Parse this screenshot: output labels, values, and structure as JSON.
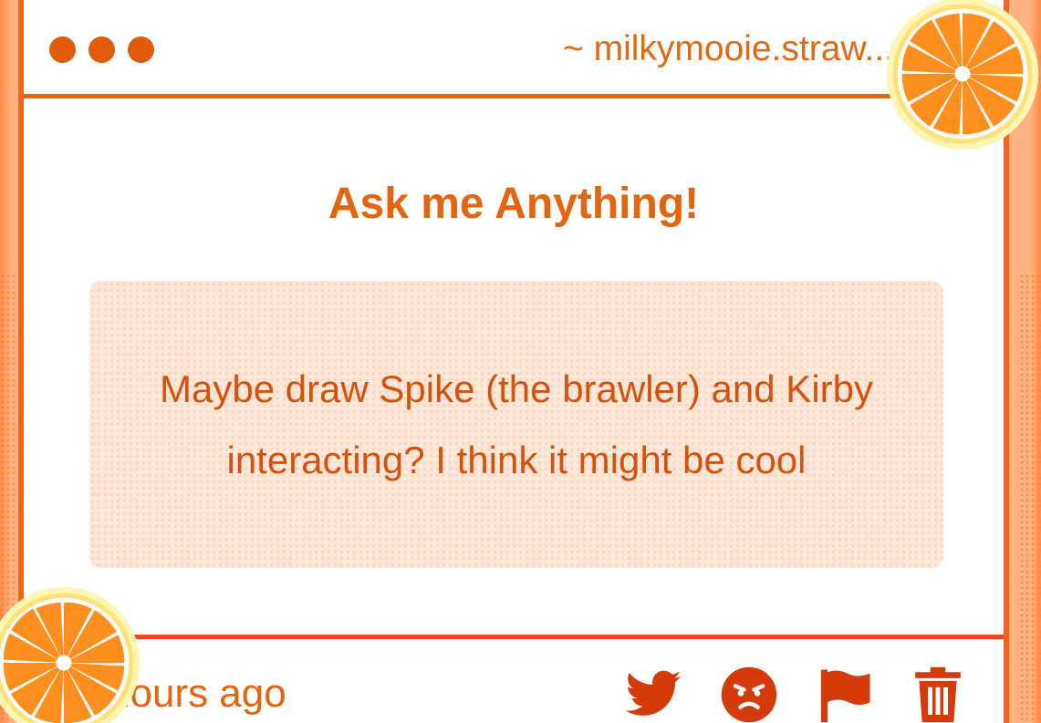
{
  "header": {
    "username": "~ milkymooie.straw..."
  },
  "main": {
    "title": "Ask me Anything!",
    "message": "Maybe draw Spike (the brawler) and Kirby interacting? I think it might be cool"
  },
  "footer": {
    "timestamp": "hours ago",
    "actions": [
      {
        "icon": "twitter-icon",
        "label": "Share on Twitter"
      },
      {
        "icon": "angry-face-icon",
        "label": "Dislike"
      },
      {
        "icon": "flag-icon",
        "label": "Report"
      },
      {
        "icon": "trash-icon",
        "label": "Delete"
      }
    ]
  },
  "colors": {
    "accent": "#e3650f",
    "border": "#f0651f",
    "icon": "#d43a0a",
    "message_bg": "#ffe7da"
  }
}
